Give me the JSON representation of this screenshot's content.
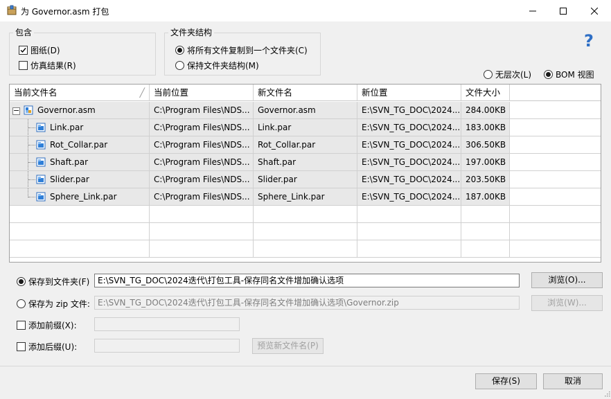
{
  "window": {
    "title": "为 Governor.asm 打包",
    "icon": "package-icon",
    "controls": [
      "minimize-icon",
      "maximize-icon",
      "close-icon"
    ]
  },
  "include_group": {
    "label": "包含",
    "options": [
      {
        "label": "图纸(D)",
        "checked": true
      },
      {
        "label": "仿真结果(R)",
        "checked": false
      }
    ]
  },
  "folder_group": {
    "label": "文件夹结构",
    "options": [
      {
        "label": "将所有文件复制到一个文件夹(C)",
        "selected": true
      },
      {
        "label": "保持文件夹结构(M)",
        "selected": false
      }
    ]
  },
  "help": {
    "glyph": "?"
  },
  "view_options": [
    {
      "label": "无层次(L)",
      "selected": false
    },
    {
      "label": "BOM 视图",
      "selected": true
    }
  ],
  "table": {
    "columns": [
      "当前文件名",
      "当前位置",
      "新文件名",
      "新位置",
      "文件大小"
    ],
    "sort_indicator": "╱",
    "rows": [
      {
        "name": "Governor.asm",
        "location": "C:\\Program Files\\NDS...",
        "new_name": "Governor.asm",
        "new_location": "E:\\SVN_TG_DOC\\2024...",
        "size": "284.00KB",
        "type": "assembly",
        "expand": "−"
      },
      {
        "name": "Link.par",
        "location": "C:\\Program Files\\NDS...",
        "new_name": "Link.par",
        "new_location": "E:\\SVN_TG_DOC\\2024...",
        "size": "183.00KB",
        "type": "part"
      },
      {
        "name": "Rot_Collar.par",
        "location": "C:\\Program Files\\NDS...",
        "new_name": "Rot_Collar.par",
        "new_location": "E:\\SVN_TG_DOC\\2024...",
        "size": "306.50KB",
        "type": "part"
      },
      {
        "name": "Shaft.par",
        "location": "C:\\Program Files\\NDS...",
        "new_name": "Shaft.par",
        "new_location": "E:\\SVN_TG_DOC\\2024...",
        "size": "197.00KB",
        "type": "part"
      },
      {
        "name": "Slider.par",
        "location": "C:\\Program Files\\NDS...",
        "new_name": "Slider.par",
        "new_location": "E:\\SVN_TG_DOC\\2024...",
        "size": "203.50KB",
        "type": "part"
      },
      {
        "name": "Sphere_Link.par",
        "location": "C:\\Program Files\\NDS...",
        "new_name": "Sphere_Link.par",
        "new_location": "E:\\SVN_TG_DOC\\2024...",
        "size": "187.00KB",
        "type": "part"
      }
    ]
  },
  "save_folder": {
    "label": "保存到文件夹(F)",
    "selected": true,
    "value": "E:\\SVN_TG_DOC\\2024迭代\\打包工具-保存同名文件增加确认选项",
    "browse": "浏览(O)..."
  },
  "save_zip": {
    "label": "保存为 zip 文件:",
    "selected": false,
    "value": "E:\\SVN_TG_DOC\\2024迭代\\打包工具-保存同名文件增加确认选项\\Governor.zip",
    "browse": "浏览(W)..."
  },
  "prefix": {
    "label": "添加前缀(X):",
    "checked": false,
    "value": ""
  },
  "suffix": {
    "label": "添加后缀(U):",
    "checked": false,
    "value": "",
    "preview": "预览新文件名(P)"
  },
  "footer": {
    "save": "保存(S)",
    "cancel": "取消"
  }
}
